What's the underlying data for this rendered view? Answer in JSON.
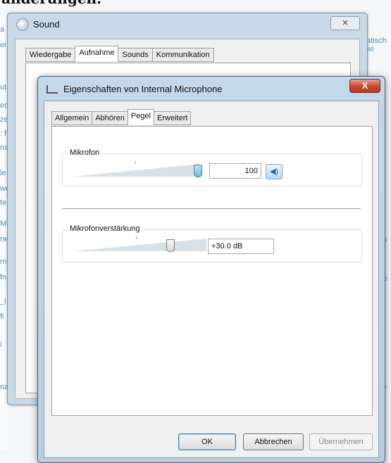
{
  "background": {
    "heading": "änderungen.",
    "left_fragments": [
      "a",
      "ei",
      "ut",
      "ec",
      "ze",
      ": f",
      "ns",
      "le",
      "we",
      "te",
      "Mi",
      "ne",
      "rn",
      "fn",
      "_i",
      "fi",
      "i",
      "nz"
    ],
    "right_fragments": [
      "atisch wi",
      "s",
      "e",
      "ie"
    ]
  },
  "sound_window": {
    "title": "Sound",
    "close_label": "✕",
    "tabs": [
      "Wiedergabe",
      "Aufnahme",
      "Sounds",
      "Kommunikation"
    ],
    "active_tab": "Aufnahme"
  },
  "properties_dialog": {
    "title": "Eigenschaften von Internal Microphone",
    "close_label": "X",
    "tabs": [
      "Allgemein",
      "Abhören",
      "Pegel",
      "Erweitert"
    ],
    "active_tab": "Pegel",
    "mikrofon": {
      "label": "Mikrofon",
      "value": "100",
      "level": 1.0,
      "speaker_icon": "speaker-icon"
    },
    "verstaerkung": {
      "label": "Mikrofonverstärkung",
      "value": "+30.0 dB",
      "level": 0.75
    },
    "buttons": {
      "ok": "OK",
      "cancel": "Abbrechen",
      "apply": "Übernehmen"
    }
  }
}
